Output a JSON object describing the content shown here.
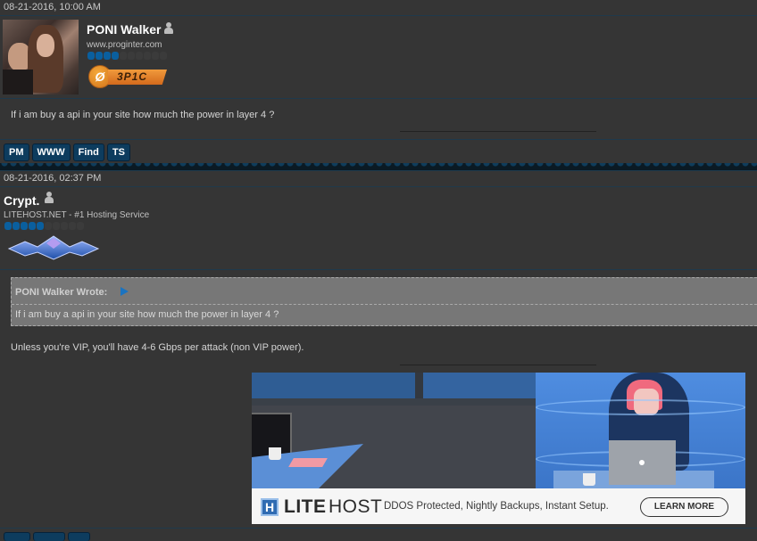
{
  "posts": [
    {
      "date": "08-21-2016, 10:00 AM",
      "author": {
        "name": "PONI Walker",
        "status_icon": "user-offline-icon",
        "usertitle": "www.proginter.com",
        "reputation": {
          "filled": 4,
          "total": 10
        },
        "badge": {
          "icon_text": "Ø",
          "label": "3P1C",
          "color": "#e8852a"
        }
      },
      "body": "If i am buy a api in your site how much the power in layer 4 ?",
      "buttons": [
        "PM",
        "WWW",
        "Find",
        "TS"
      ]
    },
    {
      "date": "08-21-2016, 02:37 PM",
      "author": {
        "name": "Crypt.",
        "status_icon": "user-offline-icon",
        "usertitle": "LITEHOST.NET - #1 Hosting Service",
        "reputation": {
          "filled": 5,
          "total": 10
        },
        "rank_emblem": "crystal-rank-emblem"
      },
      "quote": {
        "author_label": "PONI Walker Wrote:",
        "text": "If i am buy a api in your site how much the power in layer 4 ?"
      },
      "body": "Unless you're VIP, you'll have 4-6 Gbps per attack (non VIP power).",
      "ad": {
        "brand_bold": "LITE",
        "brand_light": "HOST",
        "logo_letter": "H",
        "tagline": "DDOS Protected, Nightly Backups, Instant Setup.",
        "cta": "LEARN MORE",
        "accent": "#2f6bb2"
      }
    }
  ],
  "colors": {
    "background": "#353535",
    "button_bg": "#0d3c5e",
    "rep_on": "#0a5f9e",
    "quote_bg": "#777777"
  }
}
